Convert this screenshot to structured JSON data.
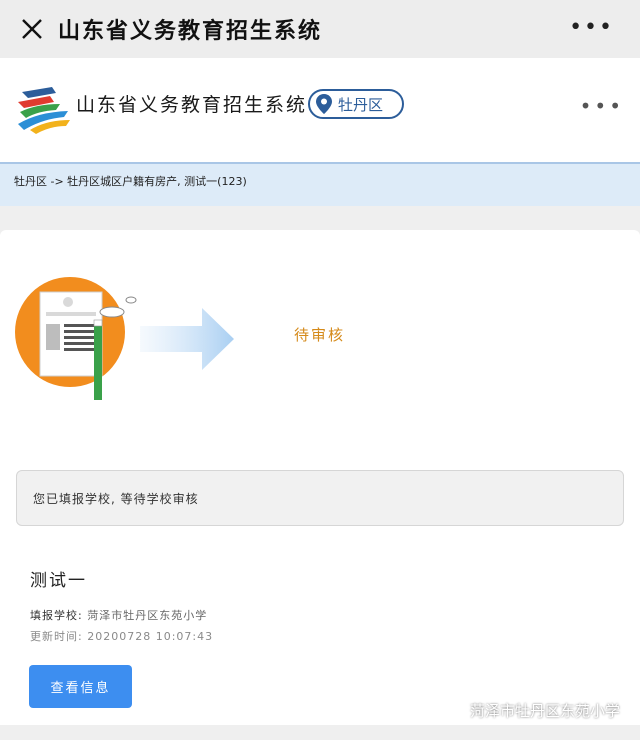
{
  "wechat_bar": {
    "title": "山东省义务教育招生系统",
    "close_icon": "close-icon",
    "more_icon": "more-dots-icon"
  },
  "header": {
    "site_title": "山东省义务教育招生系统",
    "region_label": "牡丹区",
    "location_icon": "location-pin-icon",
    "menu_icon": "more-dots-icon"
  },
  "breadcrumb": {
    "text": "牡丹区 -> 牡丹区城区户籍有房产, 测试一(123)"
  },
  "progress": {
    "status": "待审核",
    "status_color": "#d58a1a"
  },
  "notice": {
    "text": "您已填报学校, 等待学校审核"
  },
  "student": {
    "name": "测试一",
    "school_label": "填报学校:",
    "school_value": "菏泽市牡丹区东苑小学",
    "updated_label": "更新时间:",
    "updated_value": "20200728 10:07:43"
  },
  "actions": {
    "view_info": "查看信息"
  },
  "watermark": {
    "text": "菏泽市牡丹区东苑小学"
  },
  "colors": {
    "accent_blue": "#3d8ef0",
    "brand_navy": "#2c5d9a",
    "breadcrumb_bg": "#ddebf8",
    "illustration_orange": "#f28d1e"
  }
}
